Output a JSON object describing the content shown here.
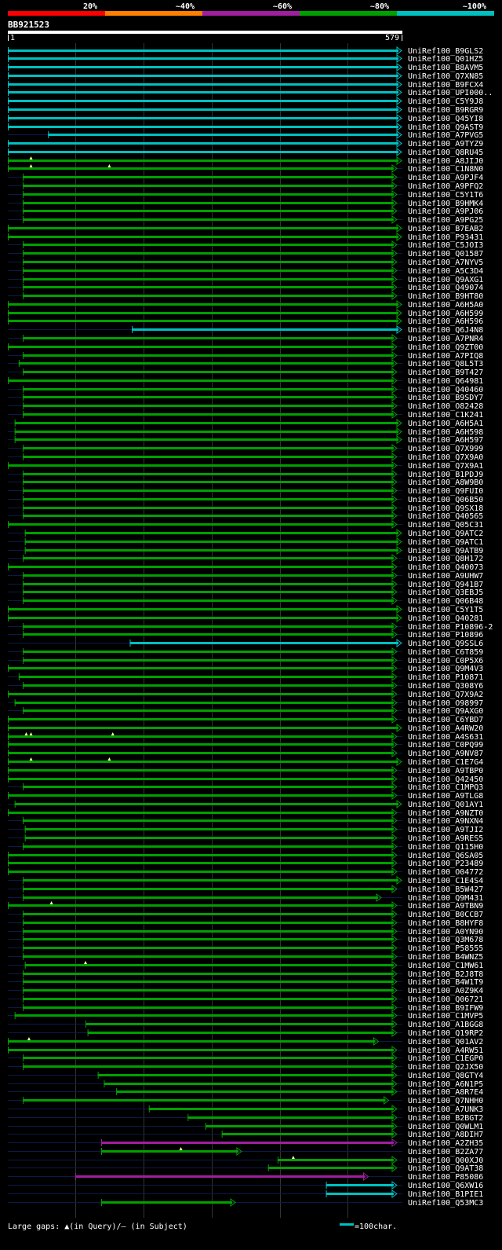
{
  "query": {
    "name": "BB921523",
    "start_label": "1",
    "end_label": "579",
    "length": 579
  },
  "identity_legend": [
    {
      "label": "20%",
      "color": "#ff0000"
    },
    {
      "label": "~40%",
      "color": "#ff7f00"
    },
    {
      "label": "~60%",
      "color": "#9f1f9f"
    },
    {
      "label": "~80%",
      "color": "#00a000"
    },
    {
      "label": "~100%",
      "color": "#00c0c0"
    }
  ],
  "footer": {
    "gap_note": "Large gaps: ▲(in Query)/– (in Subject)",
    "scale_note": "=100char."
  },
  "chart_data": {
    "type": "bar",
    "x_range": [
      1,
      579
    ],
    "colors": {
      "cyan": "#00c0c0",
      "green": "#00a000",
      "purple": "#9f1f9f"
    },
    "hits": [
      {
        "id": "UniRef100_B9GLS2",
        "start": 1,
        "end": 579,
        "color": "cyan"
      },
      {
        "id": "UniRef100_Q01HZ5",
        "start": 1,
        "end": 579,
        "color": "cyan"
      },
      {
        "id": "UniRef100_B8AVM5",
        "start": 1,
        "end": 579,
        "color": "cyan"
      },
      {
        "id": "UniRef100_Q7XN85",
        "start": 1,
        "end": 579,
        "color": "cyan"
      },
      {
        "id": "UniRef100_B9FCX4",
        "start": 1,
        "end": 579,
        "color": "cyan"
      },
      {
        "id": "UniRef100_UPI000..",
        "start": 1,
        "end": 579,
        "color": "cyan"
      },
      {
        "id": "UniRef100_C5Y9J8",
        "start": 1,
        "end": 579,
        "color": "cyan"
      },
      {
        "id": "UniRef100_B9RGR9",
        "start": 1,
        "end": 579,
        "color": "cyan"
      },
      {
        "id": "UniRef100_Q45YI8",
        "start": 1,
        "end": 579,
        "color": "cyan"
      },
      {
        "id": "UniRef100_Q9AST9",
        "start": 1,
        "end": 579,
        "color": "cyan"
      },
      {
        "id": "UniRef100_A7PVG5",
        "start": 60,
        "end": 579,
        "color": "cyan"
      },
      {
        "id": "UniRef100_A9TYZ9",
        "start": 1,
        "end": 579,
        "color": "cyan"
      },
      {
        "id": "UniRef100_Q8RU45",
        "start": 1,
        "end": 579,
        "color": "cyan"
      },
      {
        "id": "UniRef100_A8JIJ0",
        "start": 1,
        "end": 579,
        "color": "green",
        "gaps": [
          35
        ]
      },
      {
        "id": "UniRef100_C1N8N0",
        "start": 1,
        "end": 572,
        "color": "green",
        "gaps": [
          35,
          150
        ]
      },
      {
        "id": "UniRef100_A9PJF4",
        "start": 23,
        "end": 572,
        "color": "green"
      },
      {
        "id": "UniRef100_A9PFQ2",
        "start": 23,
        "end": 572,
        "color": "green"
      },
      {
        "id": "UniRef100_C5Y1T6",
        "start": 23,
        "end": 572,
        "color": "green"
      },
      {
        "id": "UniRef100_B9HMK4",
        "start": 23,
        "end": 572,
        "color": "green"
      },
      {
        "id": "UniRef100_A9PJ06",
        "start": 23,
        "end": 572,
        "color": "green"
      },
      {
        "id": "UniRef100_A9PG25",
        "start": 23,
        "end": 572,
        "color": "green"
      },
      {
        "id": "UniRef100_B7EAB2",
        "start": 1,
        "end": 579,
        "color": "green"
      },
      {
        "id": "UniRef100_P93431",
        "start": 1,
        "end": 579,
        "color": "green"
      },
      {
        "id": "UniRef100_C5JOI3",
        "start": 23,
        "end": 572,
        "color": "green"
      },
      {
        "id": "UniRef100_Q01587",
        "start": 23,
        "end": 572,
        "color": "green"
      },
      {
        "id": "UniRef100_A7NYV5",
        "start": 23,
        "end": 572,
        "color": "green"
      },
      {
        "id": "UniRef100_A5C3D4",
        "start": 23,
        "end": 572,
        "color": "green"
      },
      {
        "id": "UniRef100_Q9AXG1",
        "start": 23,
        "end": 572,
        "color": "green"
      },
      {
        "id": "UniRef100_Q49074",
        "start": 23,
        "end": 572,
        "color": "green"
      },
      {
        "id": "UniRef100_B9HT80",
        "start": 23,
        "end": 572,
        "color": "green"
      },
      {
        "id": "UniRef100_A6H5A0",
        "start": 1,
        "end": 579,
        "color": "green"
      },
      {
        "id": "UniRef100_A6H599",
        "start": 1,
        "end": 579,
        "color": "green"
      },
      {
        "id": "UniRef100_A6H596",
        "start": 1,
        "end": 579,
        "color": "green"
      },
      {
        "id": "UniRef100_Q6J4N8",
        "start": 183,
        "end": 579,
        "color": "cyan"
      },
      {
        "id": "UniRef100_A7PNR4",
        "start": 23,
        "end": 572,
        "color": "green"
      },
      {
        "id": "UniRef100_Q9ZT00",
        "start": 1,
        "end": 572,
        "color": "green"
      },
      {
        "id": "UniRef100_A7PIQ8",
        "start": 23,
        "end": 572,
        "color": "green"
      },
      {
        "id": "UniRef100_Q8L5T3",
        "start": 17,
        "end": 572,
        "color": "green"
      },
      {
        "id": "UniRef100_B9T427",
        "start": 23,
        "end": 572,
        "color": "green"
      },
      {
        "id": "UniRef100_Q64981",
        "start": 1,
        "end": 572,
        "color": "green"
      },
      {
        "id": "UniRef100_Q40460",
        "start": 23,
        "end": 572,
        "color": "green"
      },
      {
        "id": "UniRef100_B9SDY7",
        "start": 23,
        "end": 572,
        "color": "green"
      },
      {
        "id": "UniRef100_O82428",
        "start": 23,
        "end": 572,
        "color": "green"
      },
      {
        "id": "UniRef100_C1K241",
        "start": 23,
        "end": 572,
        "color": "green"
      },
      {
        "id": "UniRef100_A6H5A1",
        "start": 11,
        "end": 579,
        "color": "green"
      },
      {
        "id": "UniRef100_A6H598",
        "start": 11,
        "end": 579,
        "color": "green"
      },
      {
        "id": "UniRef100_A6H597",
        "start": 11,
        "end": 579,
        "color": "green"
      },
      {
        "id": "UniRef100_Q7X999",
        "start": 23,
        "end": 572,
        "color": "green"
      },
      {
        "id": "UniRef100_Q7X9A0",
        "start": 23,
        "end": 572,
        "color": "green"
      },
      {
        "id": "UniRef100_Q7X9A1",
        "start": 1,
        "end": 572,
        "color": "green"
      },
      {
        "id": "UniRef100_B1PDJ9",
        "start": 23,
        "end": 572,
        "color": "green"
      },
      {
        "id": "UniRef100_A8W9B0",
        "start": 23,
        "end": 572,
        "color": "green"
      },
      {
        "id": "UniRef100_Q9FUI0",
        "start": 23,
        "end": 572,
        "color": "green"
      },
      {
        "id": "UniRef100_Q06B50",
        "start": 23,
        "end": 572,
        "color": "green"
      },
      {
        "id": "UniRef100_Q9SX18",
        "start": 23,
        "end": 572,
        "color": "green"
      },
      {
        "id": "UniRef100_Q40565",
        "start": 23,
        "end": 572,
        "color": "green"
      },
      {
        "id": "UniRef100_Q05C31",
        "start": 1,
        "end": 572,
        "color": "green"
      },
      {
        "id": "UniRef100_Q9ATC2",
        "start": 26,
        "end": 579,
        "color": "green"
      },
      {
        "id": "UniRef100_Q9ATC1",
        "start": 26,
        "end": 579,
        "color": "green"
      },
      {
        "id": "UniRef100_Q9ATB9",
        "start": 26,
        "end": 579,
        "color": "green"
      },
      {
        "id": "UniRef100_Q8H172",
        "start": 23,
        "end": 572,
        "color": "green"
      },
      {
        "id": "UniRef100_Q40073",
        "start": 1,
        "end": 572,
        "color": "green"
      },
      {
        "id": "UniRef100_A9UHW7",
        "start": 23,
        "end": 572,
        "color": "green"
      },
      {
        "id": "UniRef100_Q941B7",
        "start": 23,
        "end": 572,
        "color": "green"
      },
      {
        "id": "UniRef100_Q3EBJ5",
        "start": 23,
        "end": 572,
        "color": "green"
      },
      {
        "id": "UniRef100_Q06B48",
        "start": 23,
        "end": 572,
        "color": "green"
      },
      {
        "id": "UniRef100_C5Y1T5",
        "start": 1,
        "end": 579,
        "color": "green"
      },
      {
        "id": "UniRef100_Q40281",
        "start": 1,
        "end": 579,
        "color": "green"
      },
      {
        "id": "UniRef100_P10896-2",
        "start": 23,
        "end": 572,
        "color": "green"
      },
      {
        "id": "UniRef100_P10896",
        "start": 23,
        "end": 572,
        "color": "green"
      },
      {
        "id": "UniRef100_Q9SSL6",
        "start": 180,
        "end": 579,
        "color": "cyan"
      },
      {
        "id": "UniRef100_C6T859",
        "start": 23,
        "end": 572,
        "color": "green"
      },
      {
        "id": "UniRef100_C0P5X6",
        "start": 23,
        "end": 572,
        "color": "green"
      },
      {
        "id": "UniRef100_Q9M4V3",
        "start": 1,
        "end": 572,
        "color": "green"
      },
      {
        "id": "UniRef100_P10871",
        "start": 17,
        "end": 572,
        "color": "green"
      },
      {
        "id": "UniRef100_Q308Y6",
        "start": 23,
        "end": 572,
        "color": "green"
      },
      {
        "id": "UniRef100_Q7X9A2",
        "start": 1,
        "end": 572,
        "color": "green"
      },
      {
        "id": "UniRef100_O98997",
        "start": 11,
        "end": 572,
        "color": "green"
      },
      {
        "id": "UniRef100_Q9AXG0",
        "start": 23,
        "end": 572,
        "color": "green"
      },
      {
        "id": "UniRef100_C6YBD7",
        "start": 1,
        "end": 572,
        "color": "green"
      },
      {
        "id": "UniRef100_A4RW20",
        "start": 1,
        "end": 579,
        "color": "green"
      },
      {
        "id": "UniRef100_A4S631",
        "start": 1,
        "end": 572,
        "color": "green",
        "gaps": [
          28,
          35,
          155
        ]
      },
      {
        "id": "UniRef100_C0PQ99",
        "start": 1,
        "end": 572,
        "color": "green"
      },
      {
        "id": "UniRef100_A9NV87",
        "start": 1,
        "end": 572,
        "color": "green"
      },
      {
        "id": "UniRef100_C1E7G4",
        "start": 1,
        "end": 579,
        "color": "green",
        "gaps": [
          35,
          150
        ]
      },
      {
        "id": "UniRef100_A9TBP0",
        "start": 1,
        "end": 572,
        "color": "green"
      },
      {
        "id": "UniRef100_Q42450",
        "start": 1,
        "end": 572,
        "color": "green"
      },
      {
        "id": "UniRef100_C1MPQ3",
        "start": 23,
        "end": 572,
        "color": "green"
      },
      {
        "id": "UniRef100_A9TLG8",
        "start": 1,
        "end": 572,
        "color": "green"
      },
      {
        "id": "UniRef100_Q01AY1",
        "start": 11,
        "end": 579,
        "color": "green"
      },
      {
        "id": "UniRef100_A9NZT0",
        "start": 1,
        "end": 572,
        "color": "green"
      },
      {
        "id": "UniRef100_A9NXN4",
        "start": 23,
        "end": 572,
        "color": "green"
      },
      {
        "id": "UniRef100_A9TJI2",
        "start": 26,
        "end": 572,
        "color": "green"
      },
      {
        "id": "UniRef100_A9RES5",
        "start": 26,
        "end": 572,
        "color": "green"
      },
      {
        "id": "UniRef100_Q115H0",
        "start": 23,
        "end": 572,
        "color": "green"
      },
      {
        "id": "UniRef100_Q6SA05",
        "start": 1,
        "end": 572,
        "color": "green"
      },
      {
        "id": "UniRef100_P23489",
        "start": 1,
        "end": 572,
        "color": "green"
      },
      {
        "id": "UniRef100_O04772",
        "start": 1,
        "end": 572,
        "color": "green"
      },
      {
        "id": "UniRef100_C1E4S4",
        "start": 23,
        "end": 579,
        "color": "green"
      },
      {
        "id": "UniRef100_B5W427",
        "start": 23,
        "end": 572,
        "color": "green"
      },
      {
        "id": "UniRef100_Q9M431",
        "start": 23,
        "end": 549,
        "color": "green"
      },
      {
        "id": "UniRef100_A9TBN9",
        "start": 1,
        "end": 572,
        "color": "green",
        "gaps": [
          65
        ]
      },
      {
        "id": "UniRef100_B0CCB7",
        "start": 23,
        "end": 572,
        "color": "green"
      },
      {
        "id": "UniRef100_B8HYF8",
        "start": 23,
        "end": 572,
        "color": "green"
      },
      {
        "id": "UniRef100_A0YN90",
        "start": 23,
        "end": 572,
        "color": "green"
      },
      {
        "id": "UniRef100_Q3M678",
        "start": 23,
        "end": 572,
        "color": "green"
      },
      {
        "id": "UniRef100_P58555",
        "start": 23,
        "end": 572,
        "color": "green"
      },
      {
        "id": "UniRef100_B4WNZ5",
        "start": 23,
        "end": 572,
        "color": "green"
      },
      {
        "id": "UniRef100_C1MW61",
        "start": 26,
        "end": 572,
        "color": "green",
        "gaps": [
          115
        ]
      },
      {
        "id": "UniRef100_B2J8T8",
        "start": 23,
        "end": 572,
        "color": "green"
      },
      {
        "id": "UniRef100_B4W1T9",
        "start": 23,
        "end": 572,
        "color": "green"
      },
      {
        "id": "UniRef100_A0Z9K4",
        "start": 23,
        "end": 572,
        "color": "green"
      },
      {
        "id": "UniRef100_Q06721",
        "start": 23,
        "end": 572,
        "color": "green"
      },
      {
        "id": "UniRef100_B9IFW9",
        "start": 23,
        "end": 572,
        "color": "green"
      },
      {
        "id": "UniRef100_C1MVP5",
        "start": 11,
        "end": 572,
        "color": "green"
      },
      {
        "id": "UniRef100_A1BGG8",
        "start": 115,
        "end": 572,
        "color": "green"
      },
      {
        "id": "UniRef100_Q19RP2",
        "start": 118,
        "end": 572,
        "color": "green"
      },
      {
        "id": "UniRef100_Q01AV2",
        "start": 1,
        "end": 545,
        "color": "green",
        "gaps": [
          32
        ]
      },
      {
        "id": "UniRef100_A4RW51",
        "start": 1,
        "end": 572,
        "color": "green"
      },
      {
        "id": "UniRef100_C1EGP0",
        "start": 23,
        "end": 572,
        "color": "green"
      },
      {
        "id": "UniRef100_Q2JX50",
        "start": 23,
        "end": 572,
        "color": "green"
      },
      {
        "id": "UniRef100_Q8GTY4",
        "start": 133,
        "end": 572,
        "color": "green"
      },
      {
        "id": "UniRef100_A6N1P5",
        "start": 142,
        "end": 572,
        "color": "green"
      },
      {
        "id": "UniRef100_A8R7E4",
        "start": 160,
        "end": 572,
        "color": "green"
      },
      {
        "id": "UniRef100_Q7NHH0",
        "start": 23,
        "end": 560,
        "color": "green"
      },
      {
        "id": "UniRef100_A7UNK3",
        "start": 208,
        "end": 572,
        "color": "green"
      },
      {
        "id": "UniRef100_B2BGT2",
        "start": 265,
        "end": 572,
        "color": "green"
      },
      {
        "id": "UniRef100_Q0WLM1",
        "start": 291,
        "end": 572,
        "color": "green"
      },
      {
        "id": "UniRef100_A8DIH7",
        "start": 315,
        "end": 572,
        "color": "green"
      },
      {
        "id": "UniRef100_A2ZH35",
        "start": 138,
        "end": 572,
        "color": "purple"
      },
      {
        "id": "UniRef100_B2ZA77",
        "start": 138,
        "end": 344,
        "color": "green",
        "gaps": [
          255
        ]
      },
      {
        "id": "UniRef100_Q00XJ0",
        "start": 397,
        "end": 572,
        "color": "green",
        "gaps": [
          420
        ]
      },
      {
        "id": "UniRef100_Q9AT38",
        "start": 383,
        "end": 572,
        "color": "green"
      },
      {
        "id": "UniRef100_P85086",
        "start": 100,
        "end": 530,
        "color": "purple"
      },
      {
        "id": "UniRef100_Q6XW16",
        "start": 468,
        "end": 572,
        "color": "cyan"
      },
      {
        "id": "UniRef100_B1PIE1",
        "start": 468,
        "end": 572,
        "color": "cyan"
      },
      {
        "id": "UniRef100_Q53MC3",
        "start": 138,
        "end": 335,
        "color": "green"
      }
    ]
  }
}
